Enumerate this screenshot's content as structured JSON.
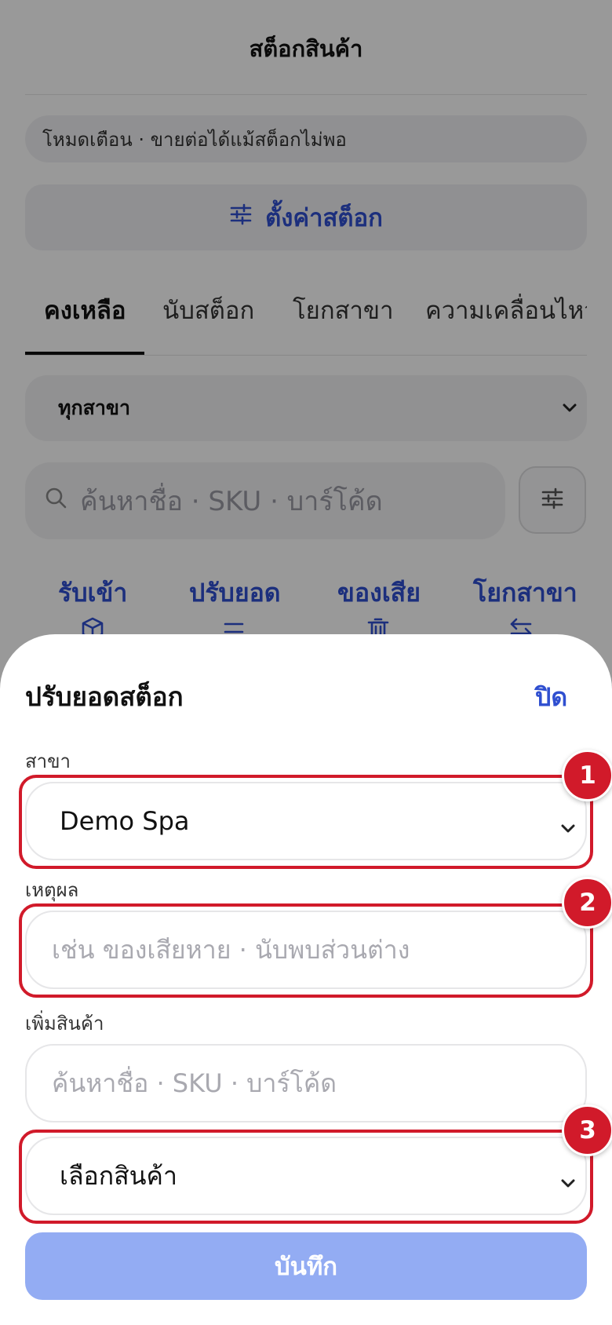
{
  "header": {
    "title": "สต็อกสินค้า"
  },
  "warning": {
    "text": "โหมดเตือน · ขายต่อได้แม้สต็อกไม่พอ"
  },
  "settings_button": {
    "label": "ตั้งค่าสต็อก",
    "icon": "sliders-icon"
  },
  "tabs": [
    {
      "label": "คงเหลือ",
      "active": true
    },
    {
      "label": "นับสต็อก",
      "active": false
    },
    {
      "label": "โยกสาขา",
      "active": false
    },
    {
      "label": "ความเคลื่อนไหว",
      "active": false
    }
  ],
  "branch_filter": {
    "value": "ทุกสาขา"
  },
  "search": {
    "placeholder": "ค้นหาชื่อ · SKU · บาร์โค้ด"
  },
  "actions": [
    {
      "label": "รับเข้า",
      "icon": "box-icon"
    },
    {
      "label": "ปรับยอด",
      "icon": "adjust-icon"
    },
    {
      "label": "ของเสีย",
      "icon": "trash-icon"
    },
    {
      "label": "โยกสาขา",
      "icon": "transfer-icon"
    }
  ],
  "sheet": {
    "title": "ปรับยอดสต็อก",
    "close_label": "ปิด",
    "branch": {
      "label": "สาขา",
      "value": "Demo Spa"
    },
    "reason": {
      "label": "เหตุผล",
      "placeholder": "เช่น ของเสียหาย · นับพบส่วนต่าง"
    },
    "add_product": {
      "label": "เพิ่มสินค้า",
      "search_placeholder": "ค้นหาชื่อ · SKU · บาร์โค้ด",
      "select_value": "เลือกสินค้า"
    },
    "save_label": "บันทึก"
  },
  "callouts": [
    "1",
    "2",
    "3"
  ],
  "colors": {
    "accent": "#2f4fd0",
    "highlight": "#d11a2a",
    "save_disabled": "#93acf3"
  }
}
